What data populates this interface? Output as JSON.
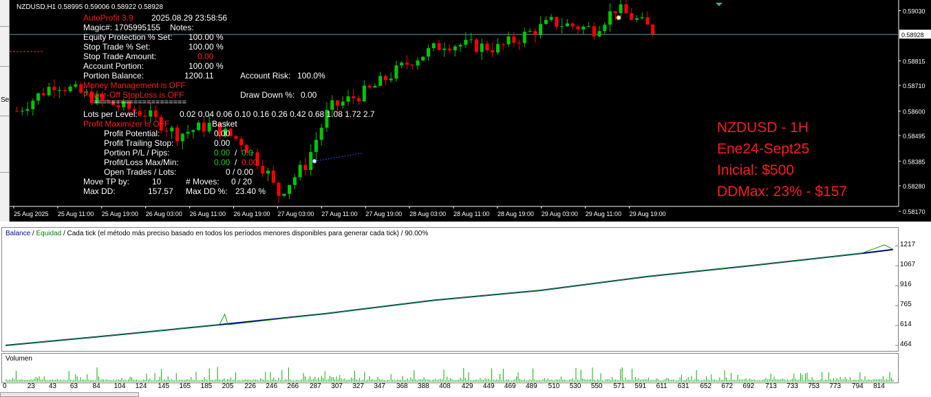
{
  "chart_window": {
    "symbol_header": "NZDUSD,H1  0.58995 0.59006 0.58922 0.58928",
    "left_tabs": [
      "Se"
    ],
    "price_axis": [
      "0.59030",
      "0.58928",
      "0.58815",
      "0.58710",
      "0.58600",
      "0.58495",
      "0.58385",
      "0.58280",
      "0.58170"
    ],
    "current_price": "0.58928",
    "time_axis": [
      "25 Aug 2025",
      "25 Aug 11:00",
      "25 Aug 19:00",
      "26 Aug 03:00",
      "26 Aug 11:00",
      "26 Aug 19:00",
      "27 Aug 03:00",
      "27 Aug 11:00",
      "27 Aug 19:00",
      "28 Aug 03:00",
      "28 Aug 11:00",
      "28 Aug 19:00",
      "29 Aug 03:00",
      "29 Aug 11:00",
      "29 Aug 19:00"
    ],
    "colors": {
      "bull": "#00c800",
      "bear": "#ff0000",
      "background": "#000000"
    }
  },
  "ea_panel": {
    "title": "AutoProfit 3.9",
    "datetime": "2025.08.29 23:58:56",
    "magic": "Magic#: 1705995155",
    "notes": "Notes:",
    "equity_protection_label": "Equity Protection % Set:",
    "equity_protection_value": "100.00 %",
    "stop_trade_pct_label": "Stop Trade % Set:",
    "stop_trade_pct_value": "100.00 %",
    "stop_trade_amount_label": "Stop Trade Amount:",
    "stop_trade_amount_value": "0.00",
    "account_portion_label": "Account Portion:",
    "account_portion_value": "100.00 %",
    "portion_balance_label": "Portion Balance:",
    "portion_balance_value": "1200.11",
    "account_risk_label": "Account Risk:",
    "account_risk_value": "100.0%",
    "money_management": "Money Management is OFF",
    "power_off_stoploss": "Power-Off StopLoss is OFF",
    "separator": "=====================",
    "draw_down_label": "Draw Down %:",
    "draw_down_value": "0.00",
    "lots_per_level_label": "Lots per Level:",
    "lots_per_level_values": "0.02  0.04  0.06  0.10  0.16  0.26  0.42  0.68  1.08  1.72  2.7",
    "profit_maximizer": "Profit Maximizer is OFF",
    "basket_label": "Basket",
    "profit_potential_label": "Profit Potential:",
    "profit_potential_value": "0.00",
    "profit_trailing_stop_label": "Profit Trailing Stop:",
    "profit_trailing_stop_value": "0.00",
    "portion_pl_label": "Portion P/L / Pips:",
    "portion_pl_value_a": "0.00",
    "portion_pl_value_b": "0.0",
    "profit_loss_maxmin_label": "Profit/Loss Max/Min:",
    "profit_loss_max": "0.00",
    "profit_loss_min": "0.00",
    "open_trades_label": "Open Trades / Lots:",
    "open_trades_value": "0  /  0.00",
    "move_tp_label": "Move TP by:",
    "move_tp_value": "10",
    "moves_label": "# Moves:",
    "moves_value": "0  / 20",
    "max_dd_label": "Max DD:",
    "max_dd_value": "157.57",
    "max_dd_pct_label": "Max DD %:",
    "max_dd_pct_value": "23.40 %",
    "slash": "/"
  },
  "annotation": {
    "line1": "NZDUSD - 1H",
    "line2": "Ene24-Sept25",
    "line3": "Inicial: $500",
    "line4": "DDMax: 23% - $157"
  },
  "balance_chart": {
    "legend_balance": "Balance",
    "legend_sep": " / ",
    "legend_equity": "Equidad",
    "legend_model": " / Cada tick (el método más preciso basado en todos los períodos menores disponibles para generar cada tick)  / 90.00%",
    "y_axis": [
      "1217",
      "1067",
      "916",
      "765",
      "614",
      "464"
    ],
    "x_axis": [
      "0",
      "23",
      "43",
      "63",
      "84",
      "104",
      "124",
      "145",
      "165",
      "185",
      "205",
      "226",
      "246",
      "266",
      "287",
      "307",
      "327",
      "347",
      "368",
      "388",
      "408",
      "429",
      "449",
      "469",
      "489",
      "510",
      "530",
      "550",
      "571",
      "591",
      "611",
      "631",
      "652",
      "672",
      "692",
      "713",
      "733",
      "753",
      "773",
      "794",
      "814"
    ],
    "volume_label": "Volumen",
    "colors": {
      "balance": "#00008b",
      "equity": "#00a000",
      "volume": "#00b000"
    }
  },
  "chart_data": {
    "type": "line",
    "title": "",
    "xlabel": "",
    "ylabel": "",
    "x_range": [
      0,
      830
    ],
    "ylim": [
      464,
      1240
    ],
    "series": [
      {
        "name": "Balance",
        "x": [
          0,
          100,
          200,
          300,
          400,
          500,
          600,
          700,
          800,
          830
        ],
        "y": [
          464,
          540,
          620,
          705,
          805,
          880,
          985,
          1070,
          1160,
          1190
        ]
      },
      {
        "name": "Equidad",
        "x": [
          0,
          100,
          200,
          205,
          208,
          300,
          400,
          500,
          600,
          700,
          800,
          822,
          830
        ],
        "y": [
          464,
          540,
          620,
          700,
          620,
          705,
          805,
          880,
          985,
          1070,
          1160,
          1225,
          1190
        ]
      }
    ]
  }
}
